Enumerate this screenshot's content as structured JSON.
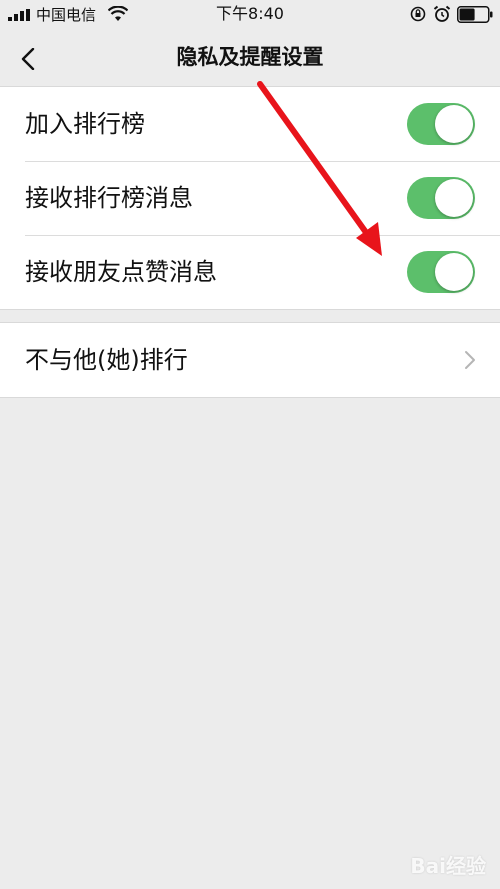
{
  "status_bar": {
    "carrier": "中国电信",
    "time": "下午8:40",
    "icons": [
      "signal-icon",
      "wifi-icon",
      "rotation-lock-icon",
      "alarm-icon",
      "battery-icon"
    ],
    "battery_level": 0.55
  },
  "nav": {
    "title": "隐私及提醒设置",
    "back_icon": "chevron-left-icon"
  },
  "settings": {
    "toggles": [
      {
        "label": "加入排行榜",
        "on": true
      },
      {
        "label": "接收排行榜消息",
        "on": true
      },
      {
        "label": "接收朋友点赞消息",
        "on": true
      }
    ],
    "links": [
      {
        "label": "不与他(她)排行",
        "icon": "chevron-right-icon"
      }
    ]
  },
  "colors": {
    "toggle_on": "#5cbf6b",
    "background": "#ececec",
    "annotation_arrow": "#e8141b"
  },
  "watermark": "Bai经验"
}
